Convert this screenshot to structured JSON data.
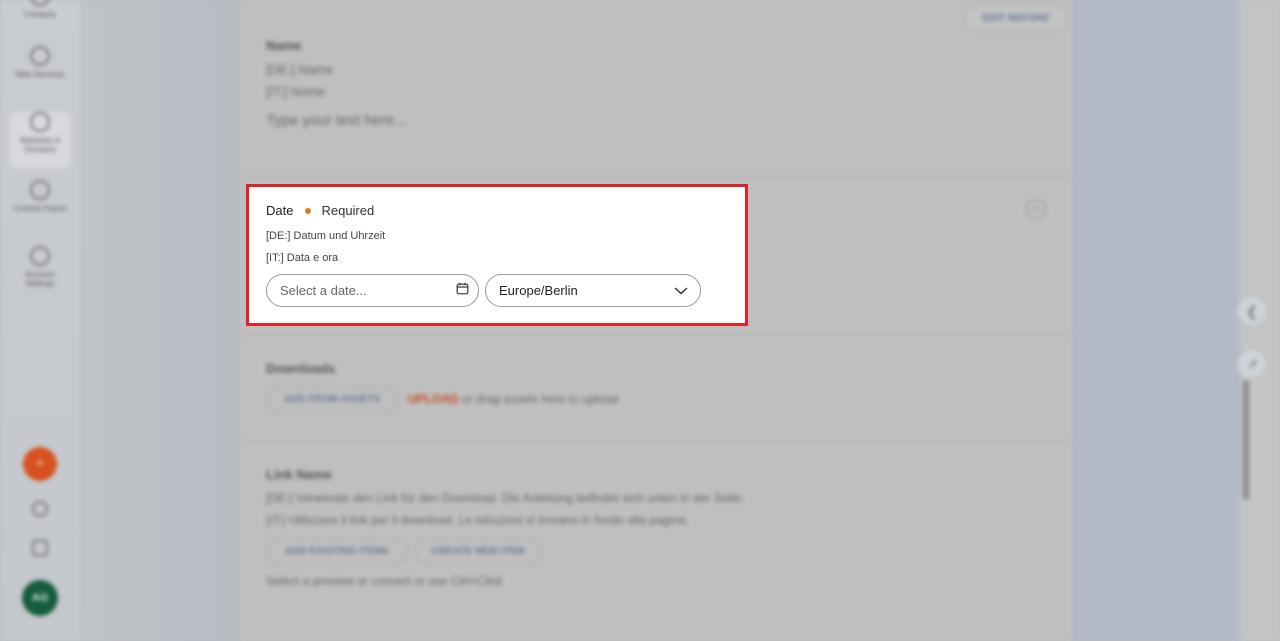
{
  "sidebar": {
    "items": [
      {
        "label": "Contacts"
      },
      {
        "label": "Web Services"
      },
      {
        "label": "Websites & Domains"
      },
      {
        "label": "Content Import"
      },
      {
        "label": "Account Settings"
      }
    ],
    "fab_label": "+",
    "avatar_initials": "AG"
  },
  "top_button": {
    "label": "EDIT BEFORE"
  },
  "section_above": {
    "heading": "Name",
    "line_de": "[DE:] Name",
    "line_it": "[IT:] Nome",
    "placeholder": "Type your text here..."
  },
  "date_field": {
    "label": "Date",
    "required_text": "Required",
    "translation_de": "[DE:] Datum und Uhrzeit",
    "translation_it": "[IT:] Data e ora",
    "date_placeholder": "Select a date...",
    "timezone_value": "Europe/Berlin"
  },
  "section_downloads": {
    "heading": "Downloads",
    "button_label": "ADD FROM ASSETS",
    "note_tag": "UPLOAD",
    "note_text": "or drag assets here to upload"
  },
  "section_link": {
    "heading": "Link Name",
    "line_de": "[DE:] Verwende den Link für den Download. Die Anleitung befindet sich unten in der Seite.",
    "line_it": "[IT:] Utilizzare il link per il download. Le istruzioni si trovano in fondo alla pagina.",
    "button_add": "ADD EXISTING ITEMS",
    "button_create": "CREATE NEW ITEM",
    "footer_text": "Select a preview or convert or use Ctrl+Click"
  },
  "colors": {
    "highlight_border": "#e0202a",
    "required_dot": "#e07a1c",
    "fab": "#d8511f",
    "avatar": "#145c3e"
  }
}
